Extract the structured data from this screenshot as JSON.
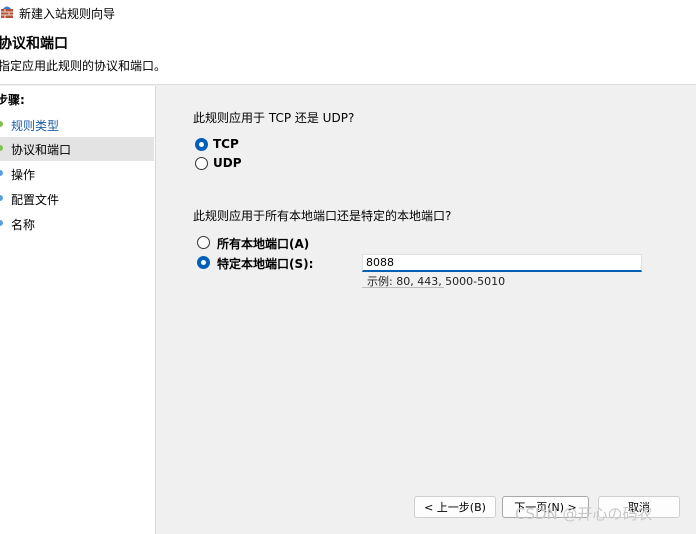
{
  "window": {
    "title": "新建入站规则向导"
  },
  "header": {
    "title": "协议和端口",
    "description": "指定应用此规则的协议和端口。"
  },
  "steps": {
    "label": "步骤:",
    "items": [
      {
        "label": "规则类型",
        "state": "done",
        "dot_color": "#7cc24c"
      },
      {
        "label": "协议和端口",
        "state": "current",
        "dot_color": "#7cc24c"
      },
      {
        "label": "操作",
        "state": "pending",
        "dot_color": "#5aa0e0"
      },
      {
        "label": "配置文件",
        "state": "pending",
        "dot_color": "#5aa0e0"
      },
      {
        "label": "名称",
        "state": "pending",
        "dot_color": "#5aa0e0"
      }
    ]
  },
  "protocol": {
    "question": "此规则应用于 TCP 还是 UDP?",
    "options": [
      {
        "label": "TCP",
        "checked": true
      },
      {
        "label": "UDP",
        "checked": false
      }
    ]
  },
  "ports": {
    "question": "此规则应用于所有本地端口还是特定的本地端口?",
    "options": [
      {
        "label": "所有本地端口(A)",
        "checked": false
      },
      {
        "label": "特定本地端口(S):",
        "checked": true
      }
    ],
    "value": "8088",
    "example": "示例: 80, 443, 5000-5010"
  },
  "buttons": {
    "back": "< 上一步(B)",
    "next": "下一页(N) >",
    "cancel": "取消"
  },
  "watermark": "CSDN @开心の码农",
  "colors": {
    "accent": "#005fb8"
  }
}
